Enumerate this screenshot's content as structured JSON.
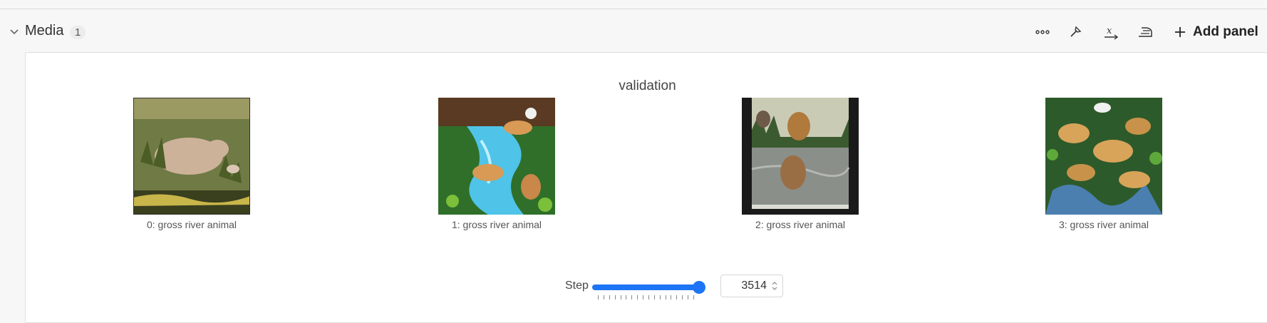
{
  "section": {
    "title": "Media",
    "count": "1",
    "add_panel_label": "Add panel",
    "toolbar_icons": [
      "more-icon",
      "magic-wand-icon",
      "x-variable-icon",
      "iron-icon",
      "plus-icon"
    ]
  },
  "panel": {
    "title": "validation",
    "items": [
      {
        "caption": "0: gross river animal",
        "scene": "swamp"
      },
      {
        "caption": "1: gross river animal",
        "scene": "waterfall"
      },
      {
        "caption": "2: gross river animal",
        "scene": "river"
      },
      {
        "caption": "3: gross river animal",
        "scene": "jungle"
      }
    ],
    "step": {
      "label": "Step",
      "value": "3514",
      "slider_fraction": 1.0
    }
  },
  "colors": {
    "accent": "#1d75f5",
    "panel_bg": "#ffffff",
    "page_bg": "#f7f7f7"
  }
}
